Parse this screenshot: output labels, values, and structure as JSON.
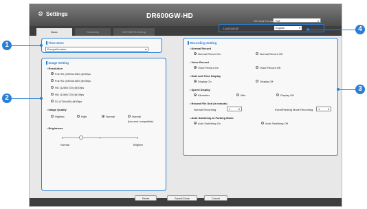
{
  "window": {
    "title": "Settings",
    "model": "DR600GW-HD",
    "sd_format_label": "SD Card Format",
    "sd_format_value": "FAT"
  },
  "tabs": [
    "Basic",
    "Sensitivity",
    "Wi-Fi/BETA Setting"
  ],
  "language": {
    "label": "LANGUAGE",
    "value": "English"
  },
  "time_zone": {
    "header": "Time Zone",
    "value": "Europe/London"
  },
  "image": {
    "header": "Image Setting",
    "resolution_label": "Resolution",
    "resolutions": [
      {
        "label": "Full HD (1920x1080) @30fps",
        "selected": true
      },
      {
        "label": "Full HD (1920x1080) @15fps",
        "selected": false
      },
      {
        "label": "HD (1280x720) @30fps",
        "selected": false
      },
      {
        "label": "HD (1280x720) @15fps",
        "selected": false
      },
      {
        "label": "D1 (720x480) @30fps",
        "selected": false
      }
    ],
    "quality_label": "Image Quality",
    "qualities": [
      {
        "label": "Highest",
        "selected": false
      },
      {
        "label": "High",
        "selected": false
      },
      {
        "label": "Normal",
        "selected": true
      },
      {
        "label": "Normal",
        "selected": false
      }
    ],
    "quality_note": "(low-end compatible)",
    "brightness_label": "Brightness",
    "brightness_min": "Normal",
    "brightness_max": "Brighter",
    "brightness_level": 0.25
  },
  "recording": {
    "header": "Recording Setting",
    "normal_record": {
      "label": "Normal Record",
      "on": "Normal Record On",
      "off": "Normal Record Off",
      "value": "on"
    },
    "voice_record": {
      "label": "Voice Record",
      "on": "Voice Record On",
      "off": "Voice Record Off",
      "value": "on"
    },
    "date_time": {
      "label": "Date and Time Display",
      "on": "Display On",
      "off": "Display Off",
      "value": "on"
    },
    "speed": {
      "label": "Speed Display",
      "options": [
        "Kilometer",
        "Mile",
        "Display Off"
      ],
      "selected": 0
    },
    "file_unit": {
      "label": "Record File Unit (in minute)",
      "normal_label": "Normal Recording",
      "normal_value": "1",
      "event_label": "Event/Parking Mode Recording",
      "event_value": "1"
    },
    "parking": {
      "label": "Auto Switching to Parking Mode",
      "on": "Auto Switching On",
      "off": "Auto Switching Off",
      "value": "on"
    }
  },
  "buttons": {
    "reset": "Reset",
    "save_close": "Save&Close",
    "cancel": "Cancel"
  },
  "callouts": [
    "1",
    "2",
    "3",
    "4"
  ],
  "accent": "#2a7fd4"
}
